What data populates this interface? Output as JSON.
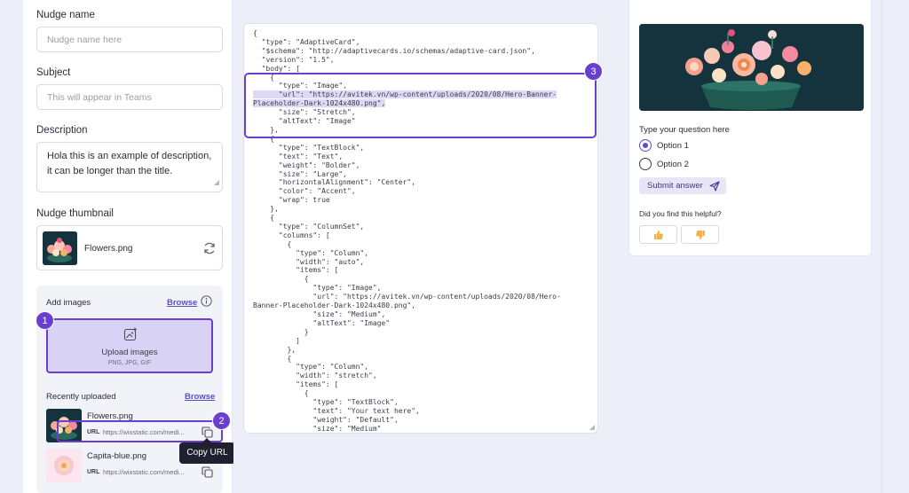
{
  "form": {
    "nudge_name_label": "Nudge name",
    "nudge_name_placeholder": "Nudge name here",
    "subject_label": "Subject",
    "subject_placeholder": "This will appear in Teams",
    "description_label": "Description",
    "description_value": "Hola this is an example of description, it can be longer than the title.",
    "thumbnail_label": "Nudge thumbnail",
    "thumbnail_file": "Flowers.png"
  },
  "add_images": {
    "title": "Add images",
    "browse_label": "Browse",
    "upload_title": "Upload images",
    "upload_formats": "PNG, JPG, GIF",
    "recent_title": "Recently uploaded",
    "recent_browse": "Browse",
    "files": [
      {
        "name": "Flowers.png",
        "url_label": "URL",
        "url": "https://wixstatic.com/medi..."
      },
      {
        "name": "Capita-blue.png",
        "url_label": "URL",
        "url": "https://wixstatic.com/medi..."
      }
    ],
    "tooltip": "Copy URL"
  },
  "badges": [
    "1",
    "2",
    "3"
  ],
  "json_editor": {
    "lines": [
      "{",
      "  \"type\": \"AdaptiveCard\",",
      "  \"$schema\": \"http://adaptivecards.io/schemas/adaptive-card.json\",",
      "  \"version\": \"1.5\",",
      "  \"body\": [",
      "    {",
      "      \"type\": \"Image\",",
      "      \"url\": \"https://avitek.vn/wp-content/uploads/2020/08/Hero-Banner-",
      "Placeholder-Dark-1024x480.png\",",
      "      \"size\": \"Stretch\",",
      "      \"altText\": \"Image\"",
      "    },",
      "    {",
      "      \"type\": \"TextBlock\",",
      "      \"text\": \"Text\",",
      "      \"weight\": \"Bolder\",",
      "      \"size\": \"Large\",",
      "      \"horizontalAlignment\": \"Center\",",
      "      \"color\": \"Accent\",",
      "      \"wrap\": true",
      "    },",
      "    {",
      "      \"type\": \"ColumnSet\",",
      "      \"columns\": [",
      "        {",
      "          \"type\": \"Column\",",
      "          \"width\": \"auto\",",
      "          \"items\": [",
      "            {",
      "              \"type\": \"Image\",",
      "              \"url\": \"https://avitek.vn/wp-content/uploads/2020/08/Hero-",
      "Banner-Placeholder-Dark-1024x480.png\",",
      "              \"size\": \"Medium\",",
      "              \"altText\": \"Image\"",
      "            }",
      "          ]",
      "        },",
      "        {",
      "          \"type\": \"Column\",",
      "          \"width\": \"stretch\",",
      "          \"items\": [",
      "            {",
      "              \"type\": \"TextBlock\",",
      "              \"text\": \"Your text here\",",
      "              \"weight\": \"Default\",",
      "              \"size\": \"Medium\""
    ],
    "highlighted_lines": [
      7,
      8
    ]
  },
  "preview": {
    "question": "Type your question here",
    "options": [
      "Option 1",
      "Option 2"
    ],
    "submit_label": "Submit answer",
    "helpful_label": "Did you find this helpful?"
  },
  "colors": {
    "accent": "#6a3fd0",
    "link": "#5a4fc8",
    "upload_bg": "#d8d3f4",
    "hero_bg": "#14333d"
  }
}
